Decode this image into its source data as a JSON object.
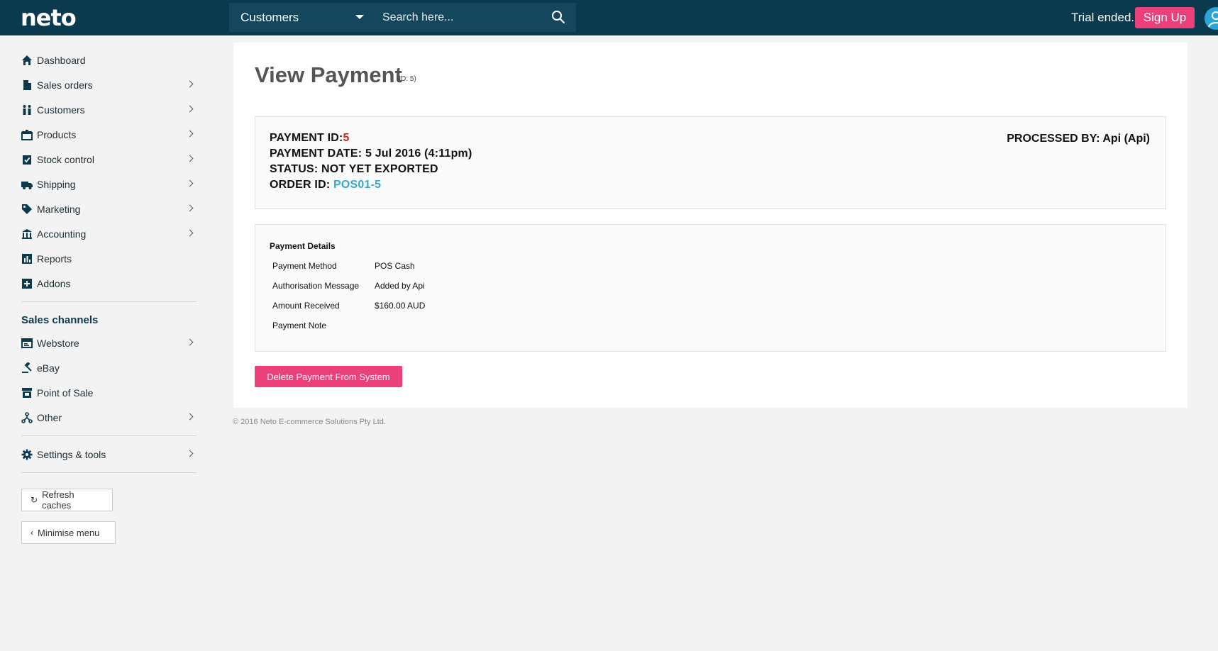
{
  "header": {
    "logo": "neto",
    "search_scope": "Customers",
    "search_placeholder": "Search here...",
    "trial_text": "Trial ended.",
    "signup_label": "Sign Up"
  },
  "sidebar": {
    "items": [
      {
        "label": "Dashboard",
        "icon": "home-icon"
      },
      {
        "label": "Sales orders",
        "icon": "document-icon"
      },
      {
        "label": "Customers",
        "icon": "people-icon"
      },
      {
        "label": "Products",
        "icon": "box-icon"
      },
      {
        "label": "Stock control",
        "icon": "clipboard-check-icon"
      },
      {
        "label": "Shipping",
        "icon": "truck-icon"
      },
      {
        "label": "Marketing",
        "icon": "tag-icon"
      },
      {
        "label": "Accounting",
        "icon": "bank-icon"
      },
      {
        "label": "Reports",
        "icon": "bar-chart-icon"
      },
      {
        "label": "Addons",
        "icon": "plus-square-icon"
      }
    ],
    "channels_title": "Sales channels",
    "channels": [
      {
        "label": "Webstore",
        "icon": "browser-window-icon"
      },
      {
        "label": "eBay",
        "icon": "gavel-icon"
      },
      {
        "label": "Point of Sale",
        "icon": "store-icon"
      },
      {
        "label": "Other",
        "icon": "network-icon"
      }
    ],
    "settings_label": "Settings & tools",
    "refresh_label": "Refresh caches",
    "minimise_label": "Minimise menu"
  },
  "page": {
    "title": "View Payment",
    "id_note": "(ID: 5)",
    "payment_id_label": "PAYMENT ID:",
    "payment_id": "5",
    "payment_date": "PAYMENT DATE: 5 Jul 2016 (4:11pm)",
    "status": "STATUS: NOT YET EXPORTED",
    "order_id_label": "ORDER ID: ",
    "order_id": "POS01-5",
    "processed_by": "PROCESSED BY: Api (Api)",
    "details_title": "Payment Details",
    "details": [
      {
        "label": "Payment Method",
        "value": "POS Cash"
      },
      {
        "label": "Authorisation Message",
        "value": "Added by Api"
      },
      {
        "label": "Amount Received",
        "value": "$160.00 AUD"
      },
      {
        "label": "Payment Note",
        "value": ""
      }
    ],
    "delete_label": "Delete Payment From System"
  },
  "footer": "© 2016 Neto E-commerce Solutions Pty Ltd.",
  "colors": {
    "topbar": "#0b3a4e",
    "accent_pink": "#ec407a",
    "link_blue": "#35a7d6",
    "id_red": "#c62828"
  }
}
